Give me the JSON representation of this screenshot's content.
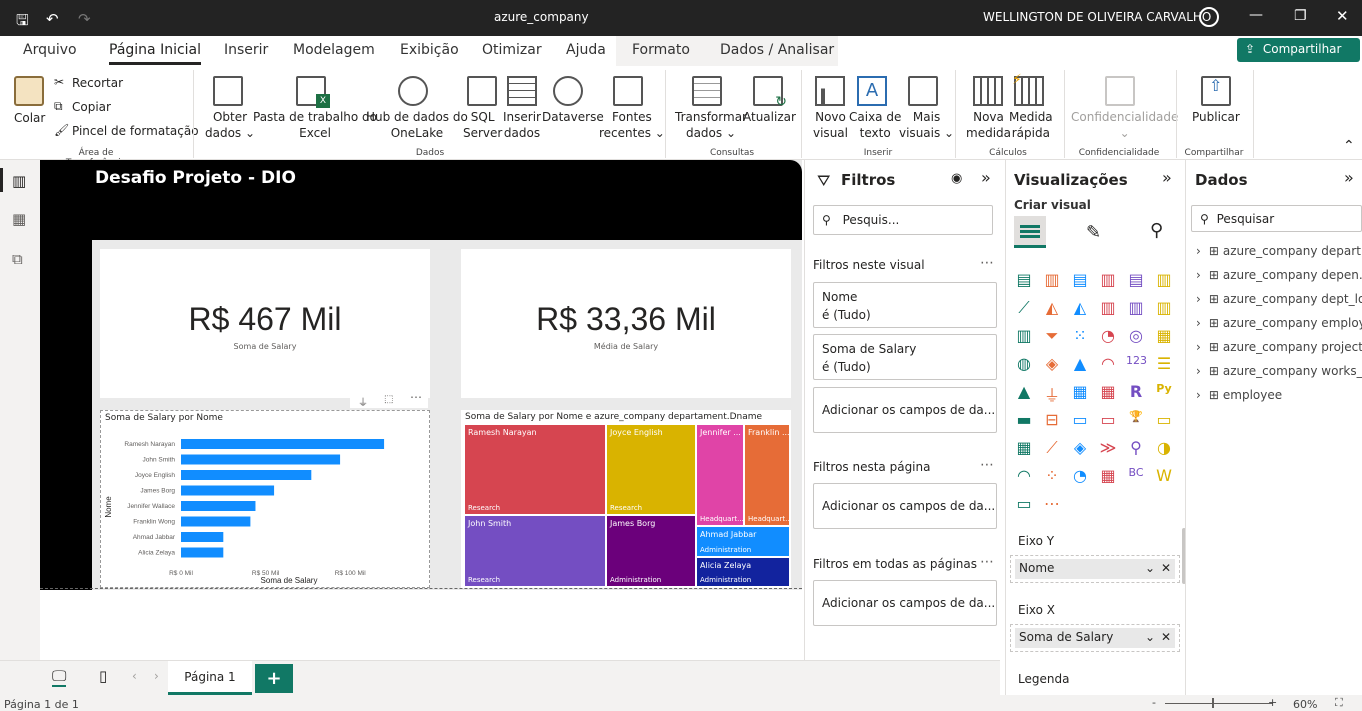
{
  "window": {
    "title": "azure_company",
    "user": "WELLINGTON DE OLIVEIRA CARVALHO"
  },
  "menu": {
    "items": [
      "Arquivo",
      "Página Inicial",
      "Inserir",
      "Modelagem",
      "Exibição",
      "Otimizar",
      "Ajuda",
      "Formato",
      "Dados / Analisar"
    ],
    "active": "Página Inicial",
    "share": "Compartilhar"
  },
  "ribbon": {
    "colar": "Colar",
    "recortar": "Recortar",
    "copiar": "Copiar",
    "pincel": "Pincel de formatação",
    "grp_area": "Área de Transferência",
    "obter": "Obter",
    "dados": "dados",
    "pasta1": "Pasta de trabalho do",
    "pasta2": "Excel",
    "hub1": "Hub de dados do",
    "hub2": "OneLake",
    "sql1": "SQL",
    "sql2": "Server",
    "ins1": "Inserir",
    "ins2": "dados",
    "dataverse": "Dataverse",
    "fontes1": "Fontes",
    "fontes2": "recentes",
    "grp_dados": "Dados",
    "transf1": "Transformar",
    "transf2": "dados",
    "atualizar": "Atualizar",
    "grp_consultas": "Consultas",
    "novo1": "Novo",
    "novo2": "visual",
    "caixa1": "Caixa de",
    "caixa2": "texto",
    "mais1": "Mais",
    "mais2": "visuais",
    "grp_inserir": "Inserir",
    "nova1": "Nova",
    "nova2": "medida",
    "medida1": "Medida",
    "medida2": "rápida",
    "grp_calc": "Cálculos",
    "conf": "Confidencialidade",
    "grp_conf": "Confidencialidade",
    "publicar": "Publicar",
    "grp_comp": "Compartilhar"
  },
  "report": {
    "title": "Desafio Projeto - DIO",
    "card1": {
      "value": "R$ 467 Mil",
      "label": "Soma de Salary"
    },
    "card2": {
      "value": "R$ 33,36 Mil",
      "label": "Média de Salary"
    },
    "bar": {
      "title": "Soma de Salary por Nome",
      "ylabel": "Nome",
      "xlabel": "Soma de Salary"
    },
    "treemap": {
      "title": "Soma de Salary por Nome e azure_company departament.Dname"
    }
  },
  "chart_data": {
    "type": "bar",
    "title": "Soma de Salary por Nome",
    "xlabel": "Soma de Salary",
    "ylabel": "Nome",
    "categories": [
      "Ramesh Narayan",
      "John Smith",
      "Joyce English",
      "James Borg",
      "Jennifer Wallace",
      "Franklin Wong",
      "Ahmad Jabbar",
      "Alicia Zelaya"
    ],
    "values": [
      120,
      94,
      77,
      55,
      44,
      41,
      25,
      25
    ],
    "xticks": [
      "R$ 0 Mil",
      "R$ 50 Mil",
      "R$ 100 Mil"
    ],
    "xlim": [
      0,
      130
    ],
    "color": "#118DFF"
  },
  "treemap_data": [
    {
      "name": "Ramesh Narayan",
      "group": "Research",
      "color": "#D64550"
    },
    {
      "name": "Joyce English",
      "group": "Research",
      "color": "#D9B300"
    },
    {
      "name": "Jennifer ...",
      "group": "Headquart...",
      "color": "#E044A7"
    },
    {
      "name": "Franklin ...",
      "group": "Headquart...",
      "color": "#E66C37"
    },
    {
      "name": "John Smith",
      "group": "Research",
      "color": "#744EC2"
    },
    {
      "name": "James Borg",
      "group": "Administration",
      "color": "#6B007B"
    },
    {
      "name": "Ahmad Jabbar",
      "group": "Administration",
      "color": "#118DFF"
    },
    {
      "name": "Alicia Zelaya",
      "group": "Administration",
      "color": "#12239E"
    }
  ],
  "filters": {
    "title": "Filtros",
    "search": "Pesquis...",
    "visual": "Filtros neste visual",
    "f1a": "Nome",
    "f1b": "é (Tudo)",
    "f2a": "Soma de Salary",
    "f2b": "é (Tudo)",
    "add": "Adicionar os campos de da...",
    "page": "Filtros nesta página",
    "all": "Filtros em todas as páginas"
  },
  "viz": {
    "title": "Visualizações",
    "create": "Criar visual",
    "eixoy": "Eixo Y",
    "eixoy_val": "Nome",
    "eixox": "Eixo X",
    "eixox_val": "Soma de Salary",
    "legenda": "Legenda"
  },
  "data": {
    "title": "Dados",
    "search": "Pesquisar",
    "items": [
      "azure_company depart...",
      "azure_company depen...",
      "azure_company dept_lo...",
      "azure_company employ...",
      "azure_company project",
      "azure_company works_...",
      "employee"
    ]
  },
  "tabs": {
    "page": "Página 1"
  },
  "status": {
    "page": "Página 1 de 1",
    "zoom": "60%"
  }
}
